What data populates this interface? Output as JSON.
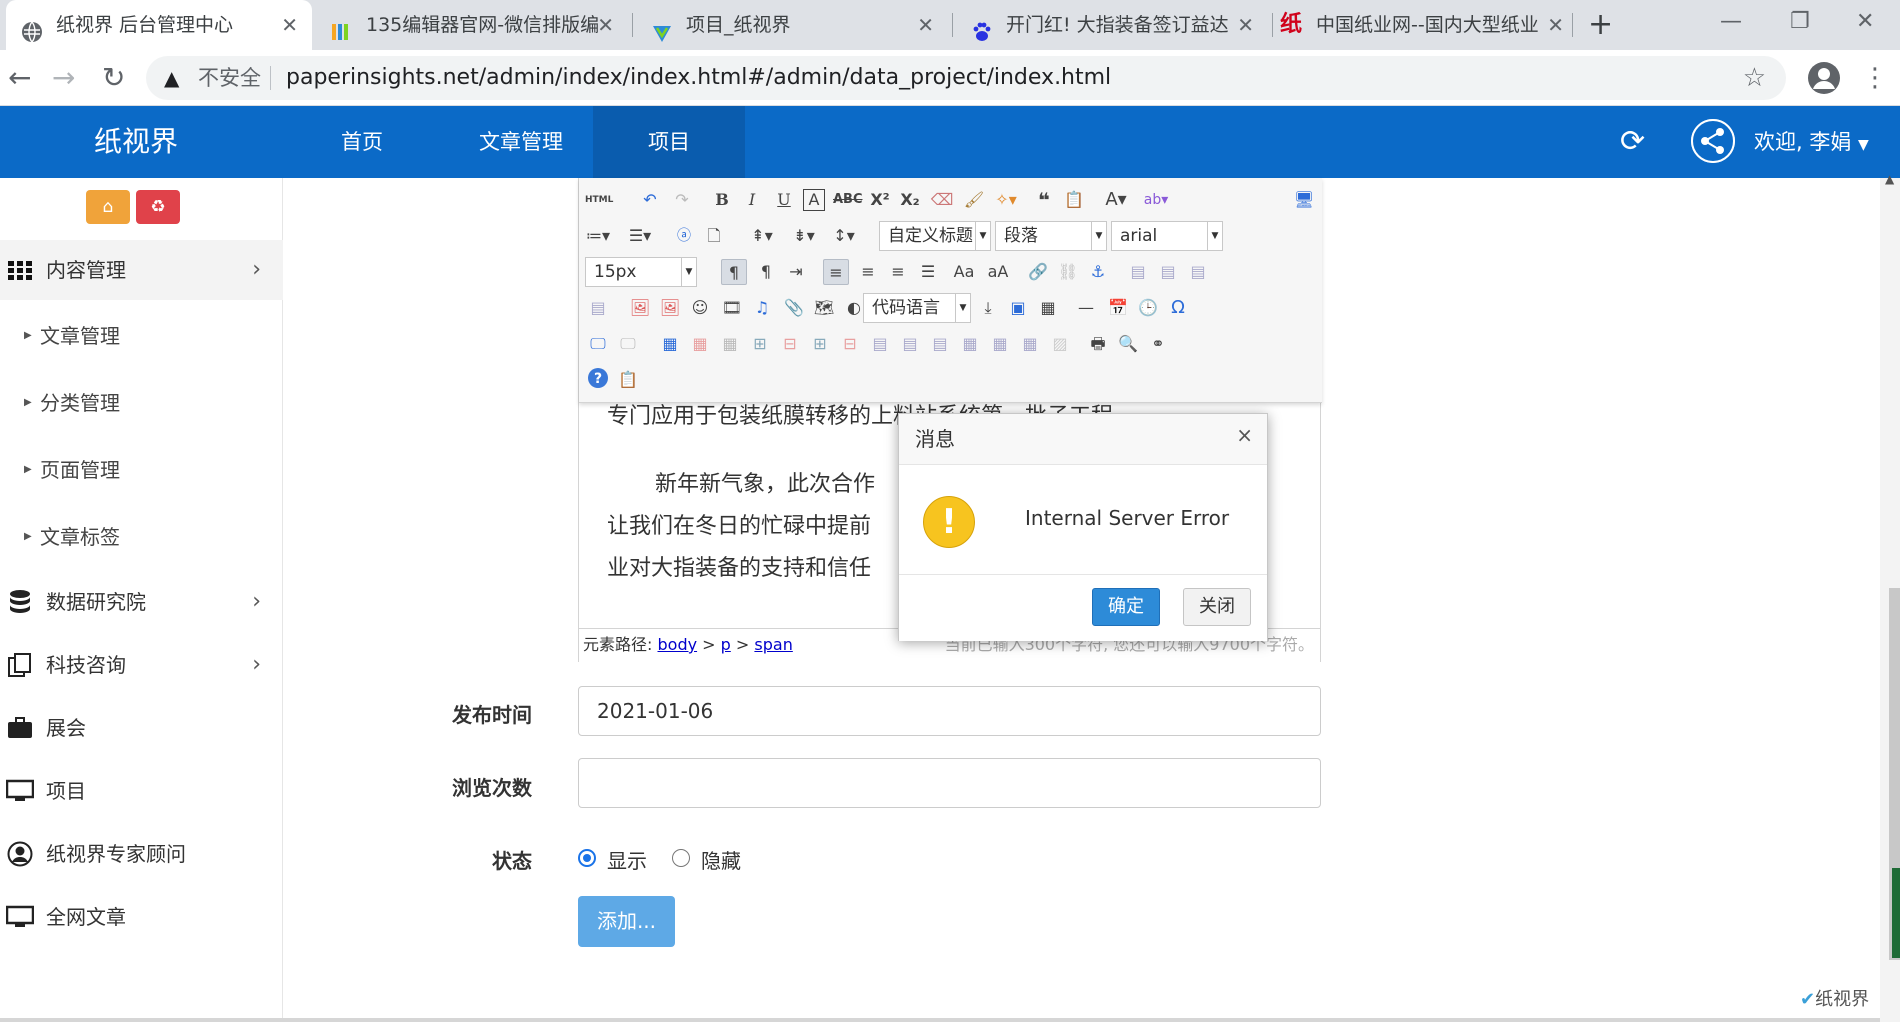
{
  "browser": {
    "tabs": [
      {
        "title": "纸视界 后台管理中心",
        "active": true,
        "favicon": "globe-icon"
      },
      {
        "title": "135编辑器官网-微信排版编",
        "active": false,
        "favicon": "editor-135-icon"
      },
      {
        "title": "项目_纸视界",
        "active": false,
        "favicon": "zhishijie-icon"
      },
      {
        "title": "开门红! 大指装备签订益达",
        "active": false,
        "favicon": "baidu-paw-icon"
      },
      {
        "title": "中国纸业网--国内大型纸业",
        "active": false,
        "favicon": "zhi-red-icon"
      }
    ],
    "not_secure": "不安全",
    "url": "paperinsights.net/admin/index/index.html#/admin/data_project/index.html"
  },
  "header": {
    "logo": "纸视界",
    "nav": [
      {
        "label": "首页"
      },
      {
        "label": "文章管理"
      },
      {
        "label": "项目"
      }
    ],
    "welcome": "欢迎, 李娟"
  },
  "sidebar": {
    "items": [
      {
        "label": "内容管理",
        "icon": "grid-icon",
        "active": true
      },
      {
        "label": "文章管理",
        "sub": true
      },
      {
        "label": "分类管理",
        "sub": true
      },
      {
        "label": "页面管理",
        "sub": true
      },
      {
        "label": "文章标签",
        "sub": true
      },
      {
        "label": "数据研究院",
        "icon": "database-icon"
      },
      {
        "label": "科技咨询",
        "icon": "copy-icon"
      },
      {
        "label": "展会",
        "icon": "briefcase-icon"
      },
      {
        "label": "项目",
        "icon": "monitor-icon"
      },
      {
        "label": "纸视界专家顾问",
        "icon": "user-circle-icon"
      },
      {
        "label": "全网文章",
        "icon": "monitor-icon"
      }
    ]
  },
  "editor": {
    "combos": {
      "title": "自定义标题",
      "paragraph": "段落",
      "font": "arial",
      "size": "15px",
      "code": "代码语言"
    },
    "content": [
      "专门应用于包装纸膜转移的上料站系统第一批子工程",
      "新年新气象，此次合作",
      "让我们在冬日的忙碌中提前",
      "业对大指装备的支持和信任"
    ],
    "path_label": "元素路径:",
    "path": [
      "body",
      "p",
      "span"
    ],
    "count": "当前已输入300个字符, 您还可以输入9700个字符。"
  },
  "form": {
    "publish_label": "发布时间",
    "publish_value": "2021-01-06",
    "views_label": "浏览次数",
    "views_value": "",
    "status_label": "状态",
    "status_show": "显示",
    "status_hide": "隐藏",
    "submit": "添加..."
  },
  "dialog": {
    "title": "消息",
    "message": "Internal Server Error",
    "ok": "确定",
    "cancel": "关闭"
  },
  "watermark": "纸视界"
}
